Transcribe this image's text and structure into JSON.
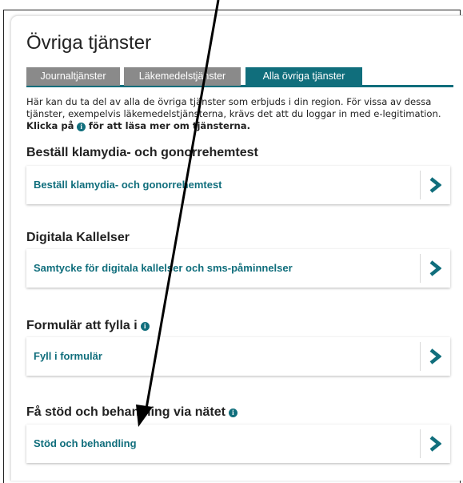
{
  "page": {
    "title": "Övriga tjänster"
  },
  "tabs": [
    {
      "label": "Journaltjänster",
      "active": false
    },
    {
      "label": "Läkemedelstjänster",
      "active": false
    },
    {
      "label": "Alla övriga tjänster",
      "active": true
    }
  ],
  "intro": {
    "text": "Här kan du ta del av alla de övriga tjänster som erbjuds i din region. För vissa av dessa tjänster, exempelvis läkemedelstjänsterna, krävs det att du loggar in med e-legitimation. ",
    "bold_prefix": "Klicka på",
    "bold_suffix": "för att läsa mer om tjänsterna."
  },
  "sections": [
    {
      "heading": "Beställ klamydia- och gonorrehemtest",
      "has_info_icon": false,
      "link": "Beställ klamydia- och gonorrehemtest"
    },
    {
      "heading": "Digitala Kallelser",
      "has_info_icon": false,
      "link": "Samtycke för digitala kallelser och sms-påminnelser"
    },
    {
      "heading": "Formulär att fylla i",
      "has_info_icon": true,
      "link": "Fyll i formulär"
    },
    {
      "heading": "Få stöd och behandling via nätet",
      "has_info_icon": true,
      "link": "Stöd och behandling"
    }
  ],
  "icons": {
    "info": "i",
    "chevron": "chevron-right-icon"
  },
  "colors": {
    "accent": "#106e7c",
    "tab_inactive": "#8a8a8a",
    "text": "#222222"
  }
}
